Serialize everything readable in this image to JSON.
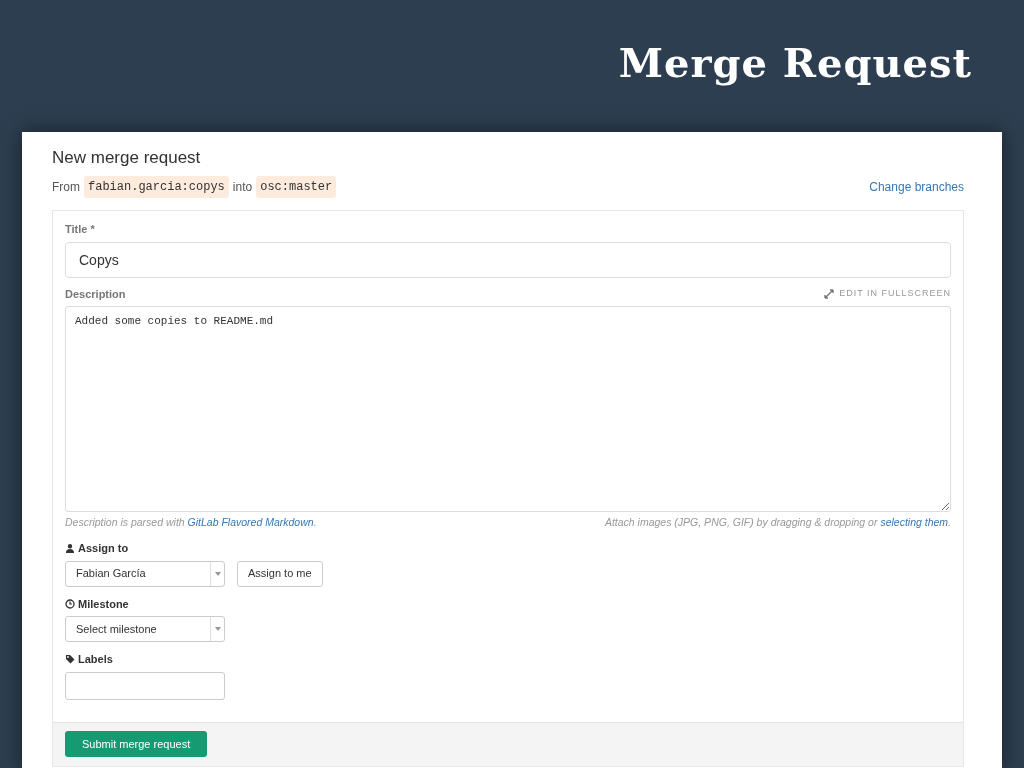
{
  "slide_title": "Merge Request",
  "page": {
    "heading": "New merge request",
    "from_label": "From",
    "source_branch": "fabian.garcia:copys",
    "into_label": "into",
    "target_branch": "osc:master",
    "change_link": "Change branches"
  },
  "form": {
    "title_label": "Title *",
    "title_value": "Copys",
    "description_label": "Description",
    "fullscreen_link": "EDIT IN FULLSCREEN",
    "description_value": "Added some copies to README.md",
    "hint_left": {
      "before": "Description is parsed with ",
      "link": "GitLab Flavored Markdown",
      "after": "."
    },
    "hint_right": {
      "before": "Attach images (JPG, PNG, GIF) by dragging & dropping or ",
      "link": "selecting them",
      "after": "."
    },
    "fields": [
      {
        "kind": "select",
        "label": "Assign to",
        "value": "Fabian García",
        "button": "Assign to me"
      },
      {
        "kind": "select",
        "label": "Milestone",
        "value": "Select milestone"
      },
      {
        "kind": "input",
        "label": "Labels"
      }
    ],
    "submit": "Submit merge request"
  }
}
